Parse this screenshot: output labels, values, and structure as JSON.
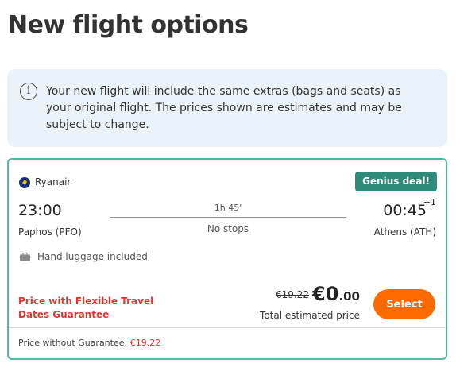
{
  "page": {
    "title": "New flight options"
  },
  "info": {
    "icon": "info-icon",
    "glyph": "i",
    "text": "Your new flight will include the same extras (bags and seats) as your original flight. The prices shown are estimates and may be subject to change."
  },
  "flight": {
    "airline": "Ryanair",
    "airline_icon": "ryanair-logo",
    "badge": "Genius deal!",
    "departure_time": "23:00",
    "departure_airport": "Paphos (PFO)",
    "arrival_time": "00:45",
    "arrival_day_offset": "+1",
    "arrival_airport": "Athens (ATH)",
    "duration": "1h 45'",
    "stops": "No stops",
    "luggage_icon": "luggage-icon",
    "luggage": "Hand luggage included"
  },
  "pricing": {
    "flex_label": "Price with Flexible Travel Dates Guarantee",
    "old_price": "€19.22",
    "new_price_main": "€0",
    "new_price_cents": ".00",
    "total_label": "Total estimated price",
    "select_label": "Select",
    "without_guarantee_label": "Price without Guarantee:",
    "without_guarantee_amount": "€19.22"
  },
  "colors": {
    "accent_teal": "#53b8a8",
    "badge_green": "#2e8b7a",
    "select_orange": "#ff6a00",
    "alert_red": "#d9382e",
    "info_bg": "#eaf3f9"
  }
}
